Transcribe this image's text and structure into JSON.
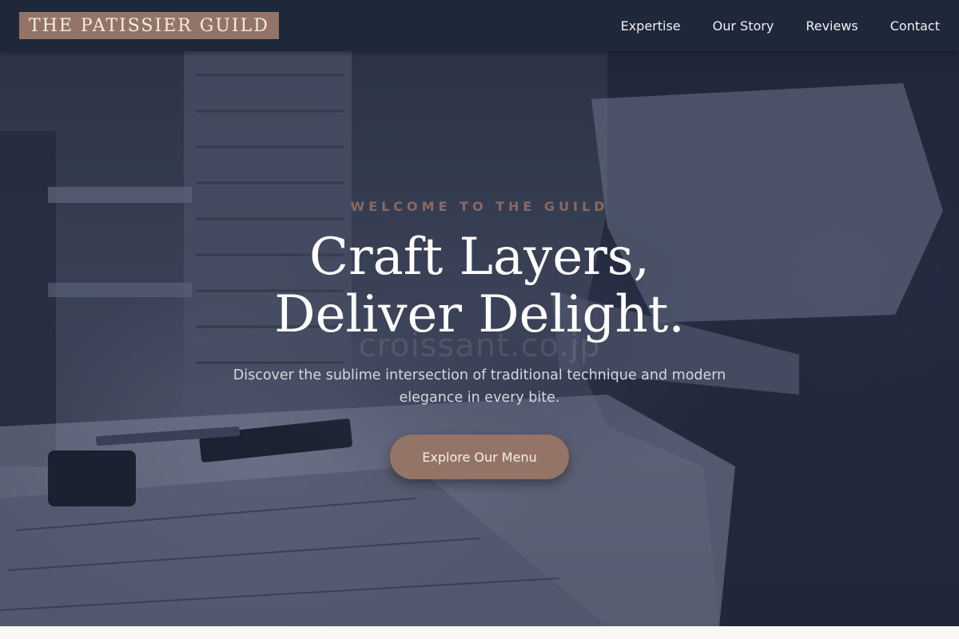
{
  "header": {
    "brand": "THE PATISSIER GUILD",
    "nav": [
      {
        "label": "Expertise"
      },
      {
        "label": "Our Story"
      },
      {
        "label": "Reviews"
      },
      {
        "label": "Contact"
      }
    ]
  },
  "hero": {
    "eyebrow": "WELCOME TO THE GUILD",
    "headline_line1": "Craft Layers,",
    "headline_line2": "Deliver Delight.",
    "watermark": "croissant.co.jp",
    "subtitle": "Discover the sublime intersection of traditional technique and modern elegance in every bite.",
    "cta_label": "Explore Our Menu",
    "background_image": "workshop-craftsman-photo"
  },
  "colors": {
    "header_bg": "#1f283b",
    "accent": "#957468",
    "eyebrow": "#8a6a60",
    "page_bg": "#faf8f4"
  }
}
